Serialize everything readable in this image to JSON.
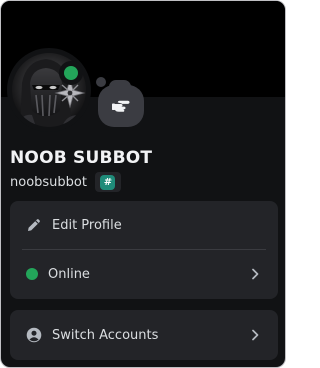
{
  "profile": {
    "display_name": "NOOB SUBBOT",
    "username": "noobsubbot",
    "tag_badge": "#",
    "status_color": "#23a55a",
    "avatar_icon": "masked-ninja-avatar",
    "status_bubble_icon": "pointing-hand-icon"
  },
  "menu": {
    "edit_profile": {
      "label": "Edit Profile",
      "icon": "pencil-icon"
    },
    "status": {
      "label": "Online",
      "icon": "online-status-dot",
      "color": "#23a55a",
      "chevron": "chevron-right-icon"
    },
    "switch_accounts": {
      "label": "Switch Accounts",
      "icon": "account-circle-icon",
      "chevron": "chevron-right-icon"
    }
  },
  "colors": {
    "panel_bg": "#111214",
    "card_bg": "#232428",
    "text": "#dbdee1",
    "online": "#23a55a"
  }
}
